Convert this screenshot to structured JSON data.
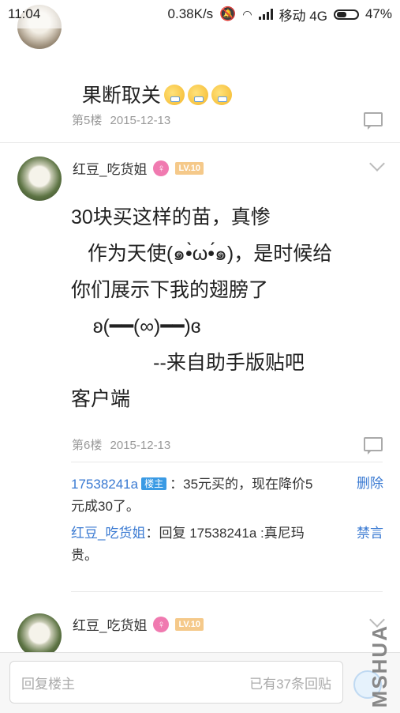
{
  "status_bar": {
    "time": "11:04",
    "speed": "0.38K/s",
    "carrier": "移动 4G",
    "battery": "47%"
  },
  "posts": [
    {
      "content": "果断取关",
      "emoji_count": 3,
      "floor": "第5楼",
      "date": "2015-12-13"
    },
    {
      "username": "红豆_吃货姐",
      "level_badge": "LV.10",
      "content_lines": [
        "30块买这样的苗，真惨",
        "   作为天使(๑•̀ω•́๑)，是时候给",
        "你们展示下我的翅膀了",
        "    ʚ(━━(∞)━━)ɞ",
        "               --来自助手版贴吧",
        "客户端"
      ],
      "floor": "第6楼",
      "date": "2015-12-13",
      "replies": [
        {
          "user": "17538241a",
          "host_tag": "楼主",
          "text_line1": "：35元买的，现在降价5",
          "text_line2": "元成30了。",
          "action": "删除"
        },
        {
          "user": "红豆_吃货姐",
          "text_line1": "：回复 17538241a :真尼玛",
          "text_line2": "贵。",
          "action": "禁言"
        }
      ]
    },
    {
      "username": "红豆_吃货姐",
      "level_badge": "LV.10"
    }
  ],
  "bottom_bar": {
    "placeholder": "回复楼主",
    "reply_count": "已有37条回贴"
  },
  "watermark": "MSHUA"
}
